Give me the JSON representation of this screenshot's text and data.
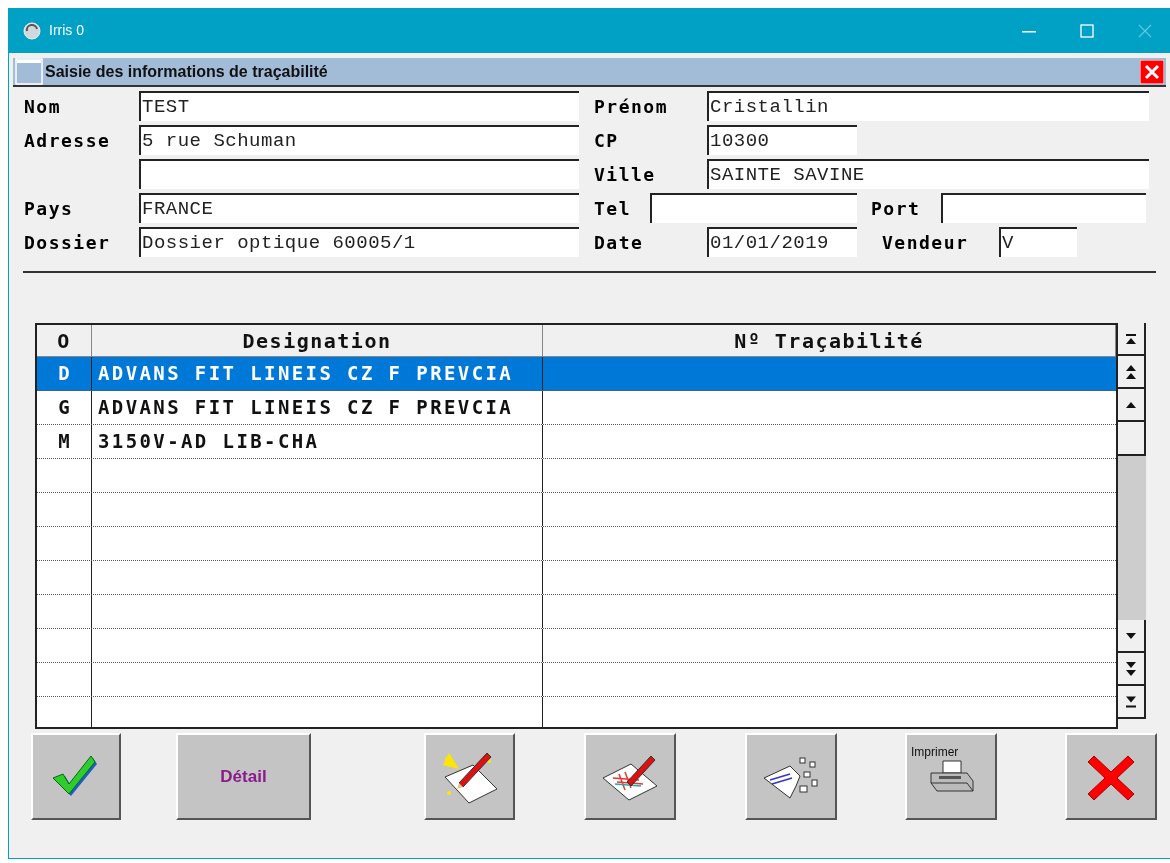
{
  "window": {
    "title": "Irris 0"
  },
  "dialog": {
    "title": "Saisie des informations de traçabilité"
  },
  "form": {
    "nom": {
      "label": "Nom",
      "value": "TEST"
    },
    "prenom": {
      "label": "Prénom",
      "value": "Cristallin"
    },
    "adresse": {
      "label": "Adresse",
      "value": "5 rue Schuman"
    },
    "cp": {
      "label": "CP",
      "value": "10300"
    },
    "ville": {
      "label": "Ville",
      "value": "SAINTE SAVINE"
    },
    "pays": {
      "label": "Pays",
      "value": "FRANCE"
    },
    "tel": {
      "label": "Tel"
    },
    "port": {
      "label": "Port"
    },
    "dossier": {
      "label": "Dossier",
      "value": "Dossier optique 60005/1"
    },
    "date": {
      "label": "Date",
      "value": "01/01/2019"
    },
    "vendeur": {
      "label": "Vendeur",
      "value": "V"
    }
  },
  "table": {
    "columns": [
      "O",
      "Designation",
      "Nº Traçabilité"
    ],
    "rows": [
      {
        "o": "D",
        "designation": "ADVANS FIT LINEIS CZ F PREVCIA",
        "selected": true
      },
      {
        "o": "G",
        "designation": "ADVANS FIT LINEIS CZ F PREVCIA",
        "selected": false
      },
      {
        "o": "M",
        "designation": "3150V-AD LIB-CHA",
        "selected": false
      }
    ]
  },
  "buttons": [
    {
      "kind": "validate"
    },
    {
      "kind": "text",
      "label": "Détail"
    },
    {
      "kind": "new"
    },
    {
      "kind": "edit"
    },
    {
      "kind": "delete"
    },
    {
      "kind": "print",
      "label": "Imprimer"
    },
    {
      "kind": "cancel"
    }
  ]
}
